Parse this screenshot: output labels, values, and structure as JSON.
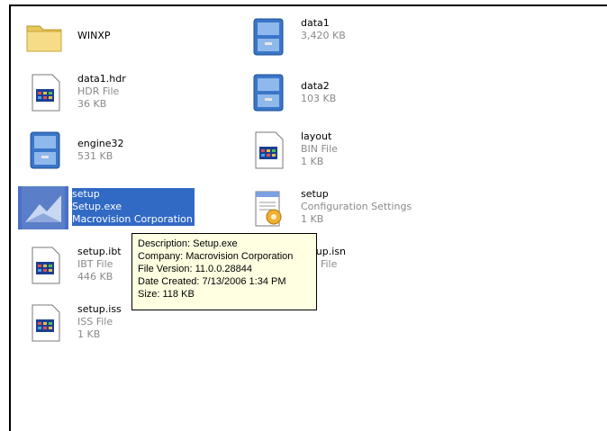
{
  "files": [
    {
      "name": "WINXP",
      "line2": "",
      "line3": "",
      "icon": "folder-icon"
    },
    {
      "name": "data1",
      "line2": "3,420 KB",
      "line3": "",
      "icon": "cabinet-icon"
    },
    {
      "name": "data1.hdr",
      "line2": "HDR File",
      "line3": "36 KB",
      "icon": "generic-file-icon"
    },
    {
      "name": "data2",
      "line2": "103 KB",
      "line3": "",
      "icon": "cabinet-icon"
    },
    {
      "name": "engine32",
      "line2": "531 KB",
      "line3": "",
      "icon": "cabinet-icon"
    },
    {
      "name": "layout",
      "line2": "BIN File",
      "line3": "1 KB",
      "icon": "generic-file-icon"
    },
    {
      "name": "setup",
      "line2": "Setup.exe",
      "line3": "Macrovision Corporation",
      "icon": "setup-exe-icon"
    },
    {
      "name": "setup",
      "line2": "Configuration Settings",
      "line3": "1 KB",
      "icon": "config-settings-icon"
    },
    {
      "name": "setup.ibt",
      "line2": "IBT File",
      "line3": "446 KB",
      "icon": "generic-file-icon"
    },
    {
      "name": "setup.isn",
      "line2": "ISN File",
      "line3": "",
      "icon": "generic-file-icon"
    },
    {
      "name": "setup.iss",
      "line2": "ISS File",
      "line3": "1 KB",
      "icon": "generic-file-icon"
    }
  ],
  "tooltip": {
    "description": "Description: Setup.exe",
    "company": "Company: Macrovision Corporation",
    "version": "File Version: 11.0.0.28844",
    "created": "Date Created: 7/13/2006 1:34 PM",
    "size": "Size: 118 KB"
  },
  "colors": {
    "selection": "#316ac5",
    "tooltip_bg": "#ffffe1"
  }
}
